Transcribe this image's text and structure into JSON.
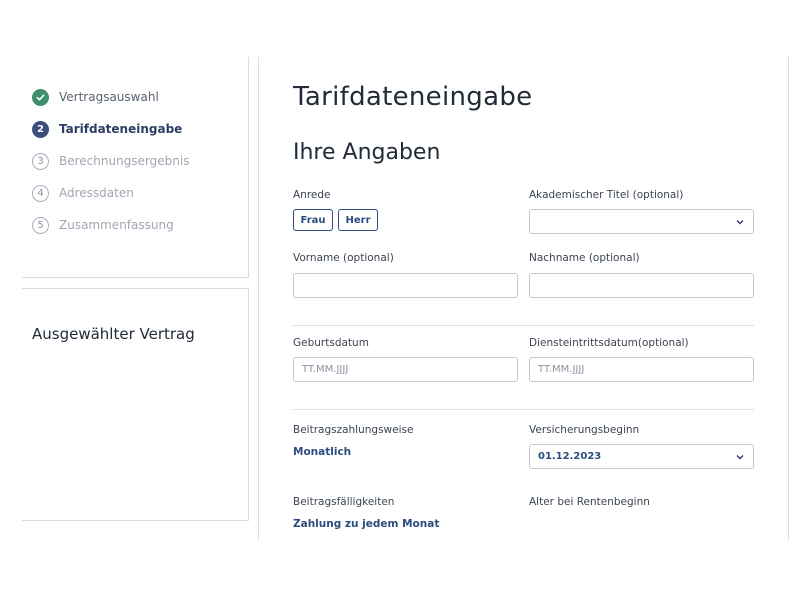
{
  "steps": [
    {
      "number": "✓",
      "label": "Vertragsauswahl",
      "state": "done"
    },
    {
      "number": "2",
      "label": "Tarifdateneingabe",
      "state": "active"
    },
    {
      "number": "3",
      "label": "Berechnungsergebnis",
      "state": "todo"
    },
    {
      "number": "4",
      "label": "Adressdaten",
      "state": "todo"
    },
    {
      "number": "5",
      "label": "Zusammenfassung",
      "state": "todo"
    }
  ],
  "contract_panel": {
    "title": "Ausgewählter Vertrag"
  },
  "main": {
    "page_title": "Tarifdateneingabe",
    "section_title": "Ihre Angaben",
    "anrede": {
      "label": "Anrede",
      "options": [
        "Frau",
        "Herr"
      ]
    },
    "akad_titel": {
      "label": "Akademischer Titel (optional)",
      "value": ""
    },
    "vorname": {
      "label": "Vorname (optional)",
      "value": ""
    },
    "nachname": {
      "label": "Nachname (optional)",
      "value": ""
    },
    "geburtsdatum": {
      "label": "Geburtsdatum",
      "placeholder": "TT.MM.JJJJ"
    },
    "diensteintritt": {
      "label": "Diensteintrittsdatum(optional)",
      "placeholder": "TT.MM.JJJJ"
    },
    "beitragszahlungsweise": {
      "label": "Beitragszahlungsweise",
      "value": "Monatlich"
    },
    "versicherungsbeginn": {
      "label": "Versicherungsbeginn",
      "value": "01.12.2023"
    },
    "faelligkeiten": {
      "label": "Beitragsfälligkeiten",
      "value": "Zahlung zu jedem Monat"
    },
    "alter_rentenbeginn": {
      "label": "Alter bei Rentenbeginn"
    }
  },
  "colors": {
    "accent": "#2c4b7f",
    "success": "#3f8f6d",
    "active_step": "#3a4f7a"
  }
}
